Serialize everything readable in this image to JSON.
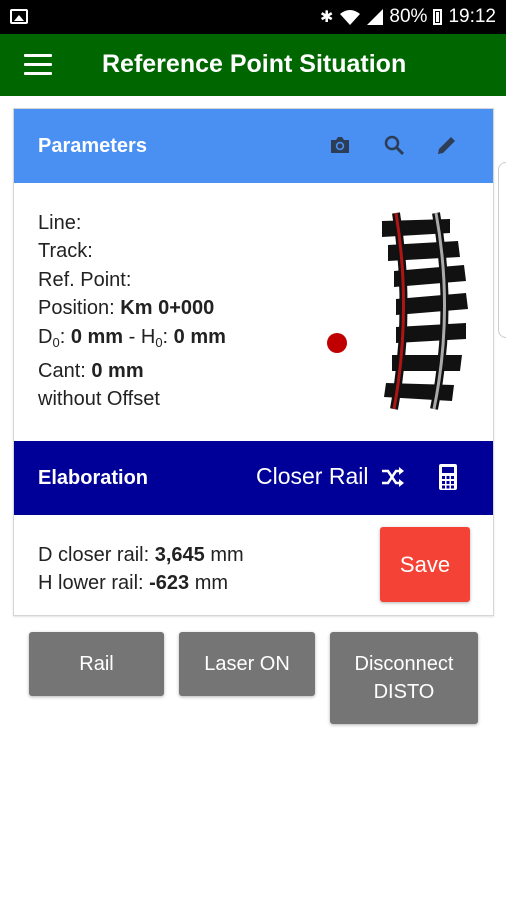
{
  "status_bar": {
    "battery_percent": "80%",
    "time": "19:12",
    "icons": [
      "gallery-icon",
      "bluetooth-icon",
      "wifi-icon",
      "signal-icon",
      "battery-icon"
    ]
  },
  "app_bar": {
    "title": "Reference Point Situation"
  },
  "parameters": {
    "header": "Parameters",
    "icons": [
      "camera-icon",
      "search-icon",
      "edit-icon"
    ],
    "line_label": "Line:",
    "track_label": "Track:",
    "ref_point_label": "Ref. Point:",
    "position_label": "Position:",
    "position_value": "Km 0+000",
    "d_label": "D",
    "d_sub": "0",
    "d_value": "0 mm",
    "h_label": "H",
    "h_sub": "0",
    "h_value": "0 mm",
    "separator": "-",
    "cant_label": "Cant:",
    "cant_value": "0 mm",
    "offset_text": "without Offset"
  },
  "elaboration": {
    "header": "Elaboration",
    "rail_mode": "Closer Rail",
    "d_closer_label": "D closer rail:",
    "d_closer_value": "3,645",
    "d_closer_unit": "mm",
    "h_lower_label": "H lower rail:",
    "h_lower_value": "-623",
    "h_lower_unit": "mm",
    "save_label": "Save"
  },
  "buttons": {
    "rail": "Rail",
    "laser": "Laser ON",
    "disconnect_line1": "Disconnect",
    "disconnect_line2": "DISTO"
  },
  "colors": {
    "app_bar": "#006600",
    "params_header": "#4a8ff2",
    "elab_header": "#000099",
    "save_button": "#f44336",
    "gray_button": "#757575",
    "dot": "#c00000"
  }
}
